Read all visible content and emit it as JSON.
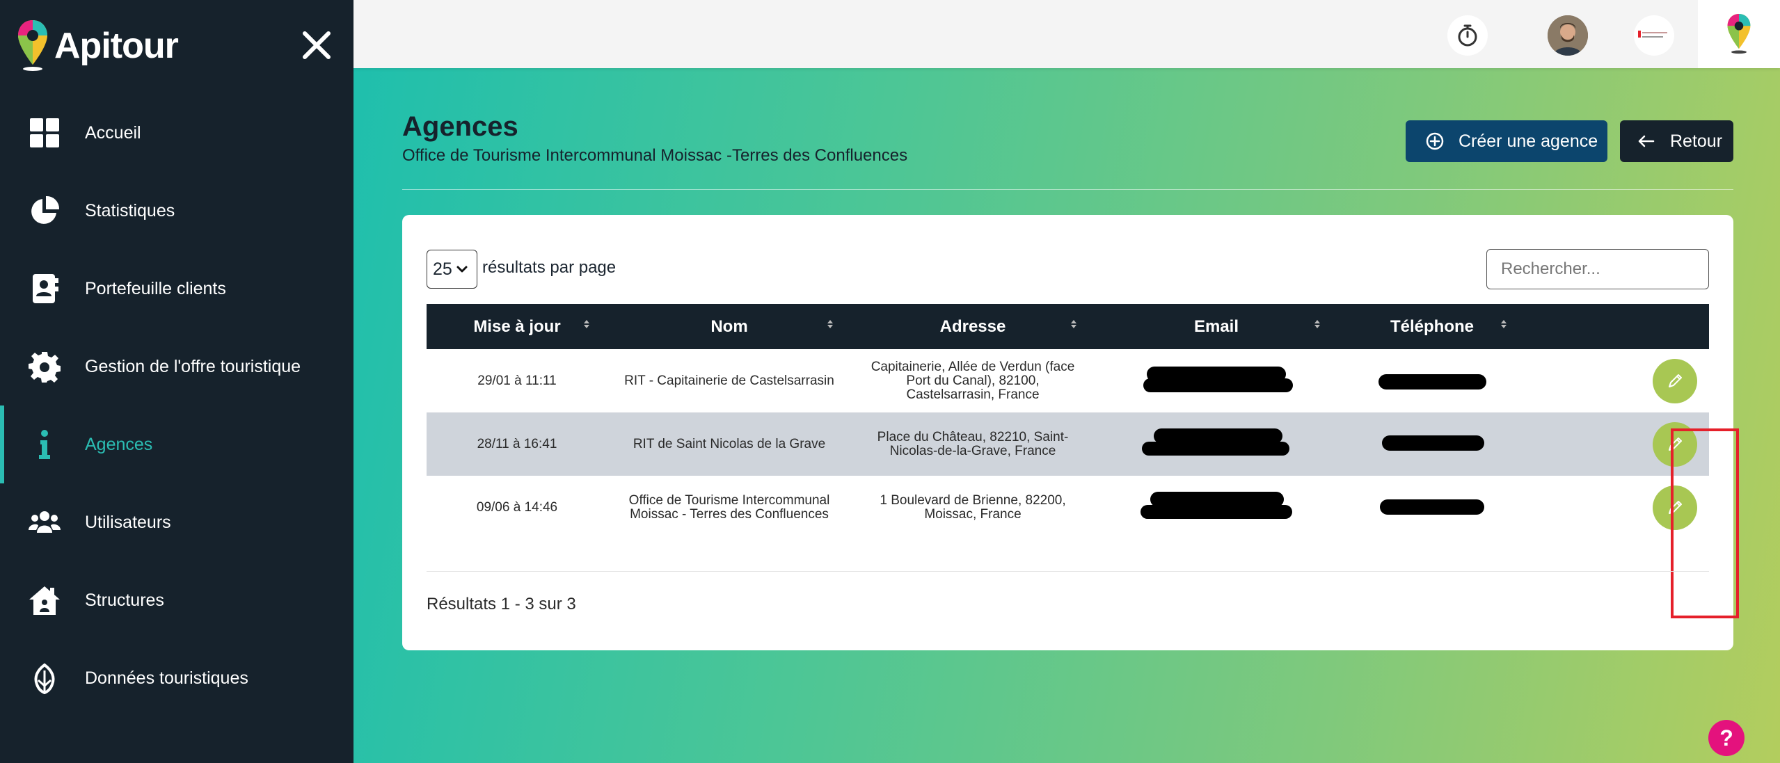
{
  "brand": {
    "name": "Apitour"
  },
  "sidebar": {
    "items": [
      {
        "label": "Accueil",
        "icon": "grid-icon"
      },
      {
        "label": "Statistiques",
        "icon": "pie-chart-icon"
      },
      {
        "label": "Portefeuille clients",
        "icon": "contact-book-icon"
      },
      {
        "label": "Gestion de l'offre touristique",
        "icon": "gear-icon"
      },
      {
        "label": "Agences",
        "icon": "info-icon",
        "active": true
      },
      {
        "label": "Utilisateurs",
        "icon": "users-icon"
      },
      {
        "label": "Structures",
        "icon": "house-icon"
      },
      {
        "label": "Données touristiques",
        "icon": "leaf-icon"
      }
    ]
  },
  "page": {
    "title": "Agences",
    "subtitle": "Office de Tourisme Intercommunal Moissac -Terres des Confluences",
    "create_label": "Créer une agence",
    "back_label": "Retour"
  },
  "table_controls": {
    "page_size": "25",
    "per_page_label": "résultats par page",
    "search_placeholder": "Rechercher..."
  },
  "table": {
    "columns": [
      "Mise à jour",
      "Nom",
      "Adresse",
      "Email",
      "Téléphone"
    ],
    "rows": [
      {
        "updated": "29/01 à 11:11",
        "name": "RIT - Capitainerie de Castelsarrasin",
        "address": "Capitainerie, Allée de Verdun (face Port du Canal), 82100, Castelsarrasin, France"
      },
      {
        "updated": "28/11 à 16:41",
        "name": "RIT de Saint Nicolas de la Grave",
        "address": "Place du Château, 82210, Saint-Nicolas-de-la-Grave, France"
      },
      {
        "updated": "09/06 à 14:46",
        "name": "Office de Tourisme Intercommunal Moissac - Terres des Confluences",
        "address": "1 Boulevard de Brienne, 82200, Moissac, France"
      }
    ]
  },
  "footer": {
    "results": "Résultats 1 - 3 sur 3"
  },
  "help": {
    "label": "?"
  },
  "colors": {
    "sidebar_bg": "#16222c",
    "accent": "#2bbdb3",
    "primary_button": "#0c456d",
    "edit_button": "#a8c753",
    "highlight": "#e5202a",
    "help_button": "#e4127d"
  }
}
